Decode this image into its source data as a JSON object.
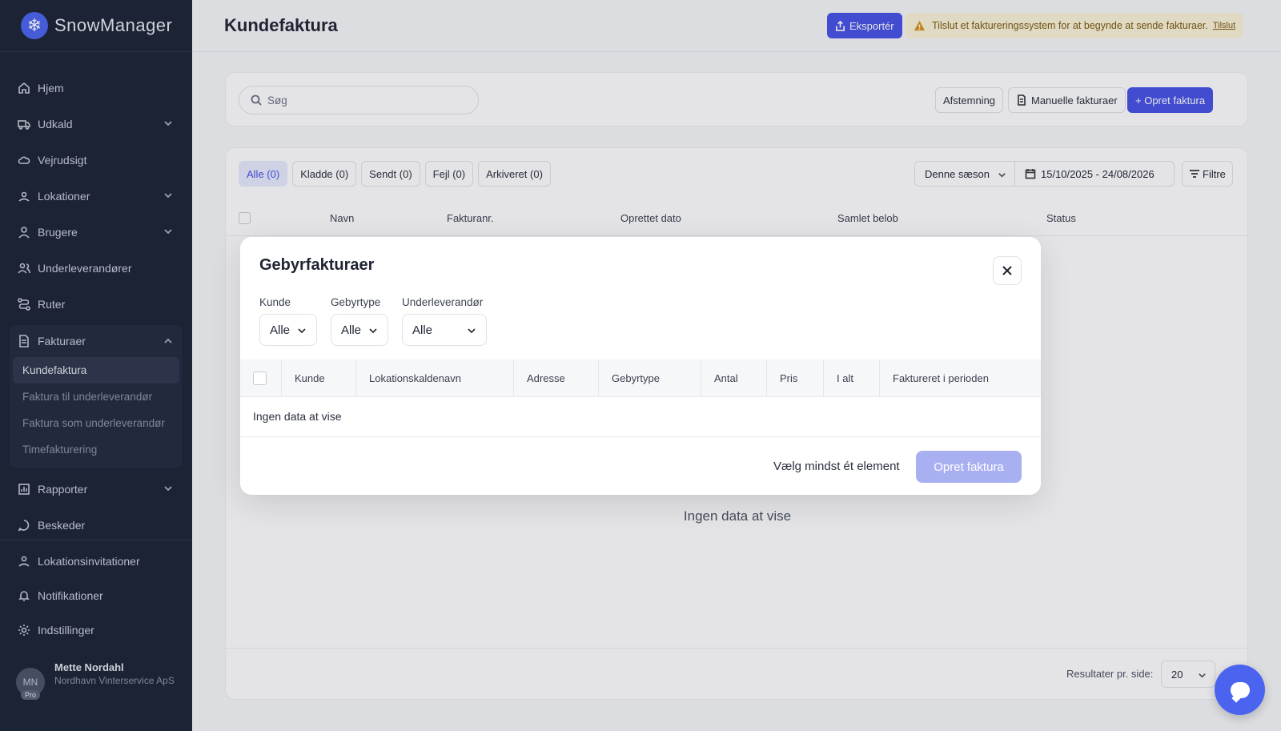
{
  "app": {
    "name": "SnowManager",
    "logo_icon": "snowflake-icon"
  },
  "sidebar": {
    "items": [
      {
        "label": "Hjem",
        "icon": "home-icon"
      },
      {
        "label": "Udkald",
        "icon": "truck-icon",
        "expandable": true
      },
      {
        "label": "Vejrudsigt",
        "icon": "cloud-icon"
      },
      {
        "label": "Lokationer",
        "icon": "location-icon",
        "expandable": true
      },
      {
        "label": "Brugere",
        "icon": "user-icon",
        "expandable": true
      },
      {
        "label": "Underleverandører",
        "icon": "users-icon"
      },
      {
        "label": "Ruter",
        "icon": "route-icon"
      }
    ],
    "invoices_group": {
      "label": "Fakturaer",
      "icon": "document-icon",
      "subitems": [
        "Kundefaktura",
        "Faktura til underleverandør",
        "Faktura som underleverandør",
        "Timefakturering"
      ],
      "active": "Kundefaktura"
    },
    "items_after": [
      {
        "label": "Rapporter",
        "icon": "chart-icon",
        "expandable": true
      },
      {
        "label": "Beskeder",
        "icon": "message-icon"
      }
    ],
    "bottom_items": [
      {
        "label": "Lokationsinvitationer",
        "icon": "location-invite-icon"
      },
      {
        "label": "Notifikationer",
        "icon": "bell-icon"
      },
      {
        "label": "Indstillinger",
        "icon": "gear-icon"
      }
    ],
    "user": {
      "initials": "MN",
      "badge": "Pro",
      "name": "Mette Nordahl",
      "org": "Nordhavn Vinterservice ApS"
    }
  },
  "header": {
    "title": "Kundefaktura",
    "export_label": "Eksportér",
    "warning_text": "Tilslut et faktureringssystem for at begynde at sende fakturaer.",
    "warning_link": "Tilslut",
    "warning_color": "#fbf3d8"
  },
  "toolbar": {
    "search_placeholder": "Søg",
    "reconcile_label": "Afstemning",
    "manual_label": "Manuelle fakturaer",
    "create_label": "+ Opret faktura"
  },
  "list": {
    "tabs": [
      "Alle (0)",
      "Kladde (0)",
      "Sendt (0)",
      "Fejl (0)",
      "Arkiveret (0)"
    ],
    "active_tab": "Alle (0)",
    "season": "Denne sæson",
    "date_range": "15/10/2025 - 24/08/2026",
    "filters_label": "Filtre",
    "columns": [
      "Navn",
      "Fakturanr.",
      "Oprettet dato",
      "Samlet belob",
      "Status"
    ],
    "empty_text": "Ingen data at vise",
    "per_page_label": "Resultater pr. side:",
    "per_page_value": "20"
  },
  "modal": {
    "title": "Gebyrfakturaer",
    "filters": [
      {
        "label": "Kunde",
        "value": "Alle"
      },
      {
        "label": "Gebyrtype",
        "value": "Alle"
      },
      {
        "label": "Underleverandør",
        "value": "Alle"
      }
    ],
    "columns": [
      "Kunde",
      "Lokationskaldenavn",
      "Adresse",
      "Gebyrtype",
      "Antal",
      "Pris",
      "I alt",
      "Faktureret i perioden"
    ],
    "empty_text": "Ingen data at vise",
    "hint": "Vælg mindst ét element",
    "create_label": "Opret faktura"
  },
  "colors": {
    "primary": "#4652e6",
    "sidebar_bg": "#1b2436",
    "disabled_primary": "#a9b0f2"
  }
}
